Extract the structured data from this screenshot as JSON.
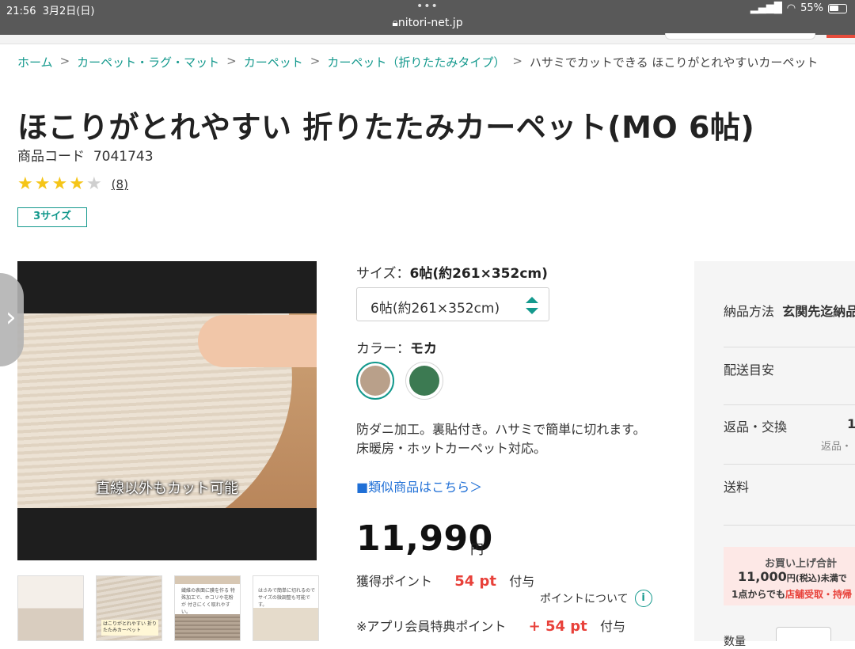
{
  "status_bar": {
    "time": "21:56",
    "date": "3月2日(日)",
    "url": "nitori-net.jp",
    "battery": "55%",
    "more": "•••"
  },
  "breadcrumbs": [
    {
      "label": "ホーム",
      "link": true
    },
    {
      "label": "カーペット・ラグ・マット",
      "link": true
    },
    {
      "label": "カーペット",
      "link": true
    },
    {
      "label": "カーペット（折りたたみタイプ）",
      "link": true
    },
    {
      "label": "ハサミでカットできる ほこりがとれやすいカーペット",
      "link": false
    }
  ],
  "breadcrumb_separator": ">",
  "product": {
    "title": "ほこりがとれやすい 折りたたみカーペット(MO 6帖)",
    "code_label": "商品コード",
    "code": "7041743",
    "rating": 4,
    "rating_max": 5,
    "review_count": "(8)",
    "size_badge": "3サイズ",
    "image_caption": "直線以外もカット可能",
    "thumb_texts": [
      "はこりがとれやすい 折りたたみカーペット",
      "繊維の表面に膜を作る 特殊加工で、ホコリや花粉が 付きにくく取れやすい。",
      "はさみで簡単に切れるので サイズの微調整も可能です。"
    ]
  },
  "size": {
    "label": "サイズ：",
    "value": "6帖(約261×352cm)",
    "select_value": "6帖(約261×352cm)"
  },
  "color": {
    "label": "カラー：",
    "value": "モカ",
    "swatches": [
      {
        "name": "モカ",
        "hex": "#b9a08a",
        "selected": true
      },
      {
        "name": "グリーン",
        "hex": "#3c7a52",
        "selected": false
      }
    ]
  },
  "description": "防ダニ加工。裏貼付き。ハサミで簡単に切れます。床暖房・ホットカーペット対応。",
  "similar_link": "■類似商品はこちら＞",
  "price": {
    "amount": "11,990",
    "unit": "円"
  },
  "points": {
    "label": "獲得ポイント",
    "value": "54 pt",
    "suffix": "付与",
    "about": "ポイントについて",
    "app_label": "※アプリ会員特典ポイント",
    "app_value": "+ 54 pt",
    "app_suffix": "付与"
  },
  "sidebar": {
    "delivery_method_label": "納品方法",
    "delivery_method_value": "玄関先迄納品",
    "delivery_eta": "配送目安",
    "returns": "返品・交換",
    "returns_fragment": "1",
    "returns_small": "返品・",
    "shipping": "送料",
    "promo_line1": "お買い上げ合計",
    "promo_line2": "11,000",
    "promo_line2_unit": "円(税込)未満で",
    "promo_line3_a": "1点からでも",
    "promo_line3_b": "店舗受取・持帰",
    "quantity_label": "数量"
  }
}
